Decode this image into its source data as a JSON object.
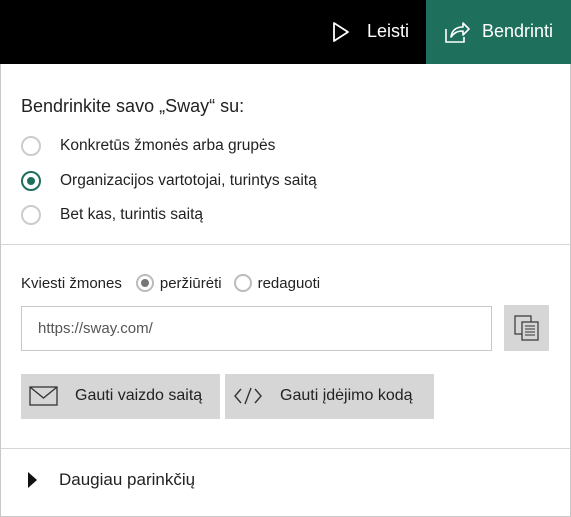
{
  "header": {
    "play_label": "Leisti",
    "share_label": "Bendrinti",
    "play_icon": "play-icon",
    "share_icon": "share-icon",
    "accent_color": "#1f6f5d"
  },
  "share": {
    "heading": "Bendrinkite savo „Sway“ su:",
    "options": [
      {
        "label": "Konkretūs žmonės arba grupės",
        "selected": false
      },
      {
        "label": "Organizacijos vartotojai, turintys saitą",
        "selected": true
      },
      {
        "label": "Bet kas, turintis saitą",
        "selected": false
      }
    ]
  },
  "invite": {
    "label": "Kviesti žmones",
    "view_label": "peržiūrėti",
    "edit_label": "redaguoti",
    "view_selected": true
  },
  "link": {
    "value": "https://sway.com/",
    "copy_icon": "copy-icon"
  },
  "actions": {
    "view_link_label": "Gauti vaizdo saitą",
    "embed_code_label": "Gauti įdėjimo kodą",
    "mail_icon": "mail-icon",
    "code_icon": "code-icon"
  },
  "more": {
    "label": "Daugiau parinkčių"
  }
}
